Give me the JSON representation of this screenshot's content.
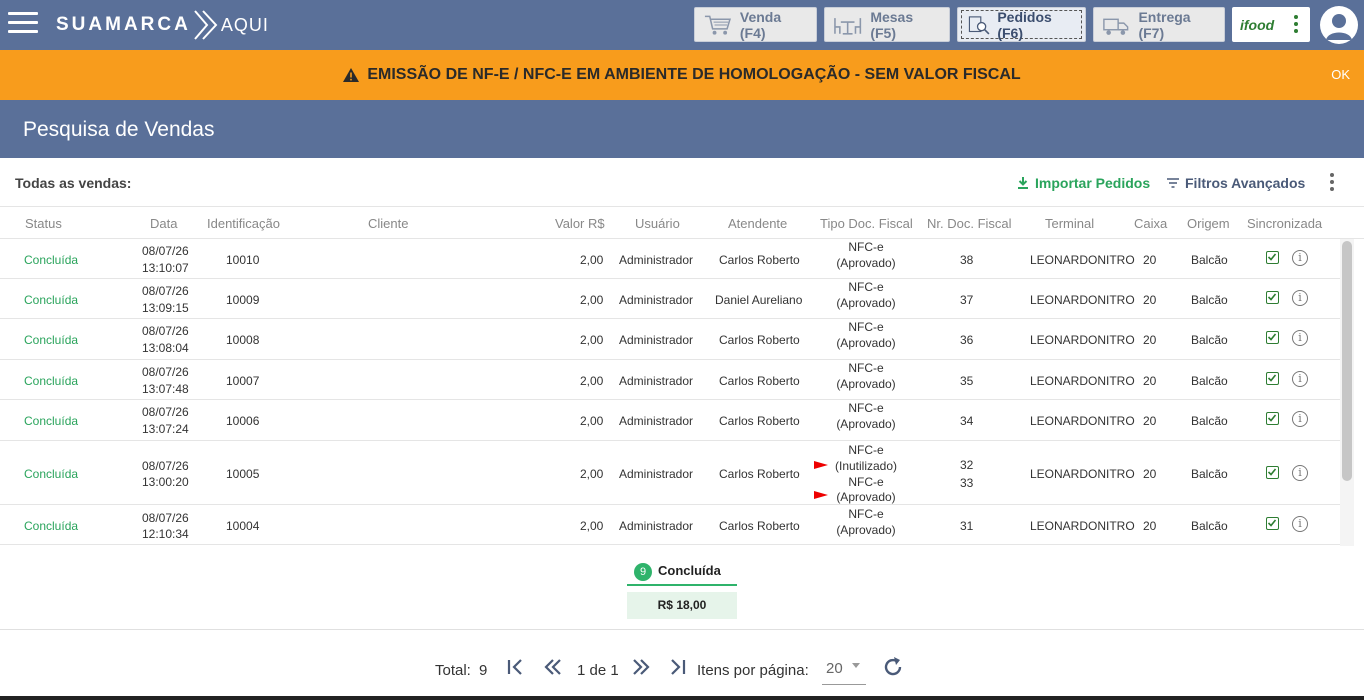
{
  "app": {
    "logo_main": "SUAMARCA",
    "logo_sub": "AQUI"
  },
  "nav": [
    {
      "label": "Venda (F4)",
      "icon": "cart-icon",
      "active": false
    },
    {
      "label": "Mesas (F5)",
      "icon": "tables-icon",
      "active": false
    },
    {
      "label": "Pedidos (F6)",
      "icon": "order-search-icon",
      "active": true
    },
    {
      "label": "Entrega (F7)",
      "icon": "delivery-truck-icon",
      "active": false
    }
  ],
  "ifood_label": "ifood",
  "warning": {
    "text": "EMISSÃO DE NF-E / NFC-E EM AMBIENTE DE HOMOLOGAÇÃO - SEM VALOR FISCAL",
    "ok": "OK"
  },
  "page": {
    "title": "Pesquisa de Vendas",
    "subtitle": "Todas as vendas:",
    "import_label": "Importar Pedidos",
    "filter_label": "Filtros Avançados"
  },
  "table": {
    "headers": [
      "Status",
      "Data",
      "Identificação",
      "Cliente",
      "Valor R$",
      "Usuário",
      "Atendente",
      "Tipo Doc. Fiscal",
      "Nr. Doc. Fiscal",
      "Terminal",
      "Caixa",
      "Origem",
      "Sincronizada"
    ],
    "rows": [
      {
        "status": "Concluída",
        "date": "08/07/26",
        "time": "13:10:07",
        "id": "10010",
        "client": "",
        "value": "2,00",
        "user": "Administrador",
        "attendant": "Carlos Roberto",
        "doc_type": "NFC-e",
        "doc_status": "(Aprovado)",
        "doc_nr": "38",
        "terminal": "LEONARDONITRO",
        "caixa": "20",
        "origem": "Balcão",
        "synced": true
      },
      {
        "status": "Concluída",
        "date": "08/07/26",
        "time": "13:09:15",
        "id": "10009",
        "client": "",
        "value": "2,00",
        "user": "Administrador",
        "attendant": "Daniel Aureliano",
        "doc_type": "NFC-e",
        "doc_status": "(Aprovado)",
        "doc_nr": "37",
        "terminal": "LEONARDONITRO",
        "caixa": "20",
        "origem": "Balcão",
        "synced": true
      },
      {
        "status": "Concluída",
        "date": "08/07/26",
        "time": "13:08:04",
        "id": "10008",
        "client": "",
        "value": "2,00",
        "user": "Administrador",
        "attendant": "Carlos Roberto",
        "doc_type": "NFC-e",
        "doc_status": "(Aprovado)",
        "doc_nr": "36",
        "terminal": "LEONARDONITRO",
        "caixa": "20",
        "origem": "Balcão",
        "synced": true
      },
      {
        "status": "Concluída",
        "date": "08/07/26",
        "time": "13:07:48",
        "id": "10007",
        "client": "",
        "value": "2,00",
        "user": "Administrador",
        "attendant": "Carlos Roberto",
        "doc_type": "NFC-e",
        "doc_status": "(Aprovado)",
        "doc_nr": "35",
        "terminal": "LEONARDONITRO",
        "caixa": "20",
        "origem": "Balcão",
        "synced": true
      },
      {
        "status": "Concluída",
        "date": "08/07/26",
        "time": "13:07:24",
        "id": "10006",
        "client": "",
        "value": "2,00",
        "user": "Administrador",
        "attendant": "Carlos Roberto",
        "doc_type": "NFC-e",
        "doc_status": "(Aprovado)",
        "doc_nr": "34",
        "terminal": "LEONARDONITRO",
        "caixa": "20",
        "origem": "Balcão",
        "synced": true
      },
      {
        "status": "Concluída",
        "date": "08/07/26",
        "time": "13:00:20",
        "id": "10005",
        "client": "",
        "value": "2,00",
        "user": "Administrador",
        "attendant": "Carlos Roberto",
        "doc_type": "NFC-e",
        "doc_status": "(Inutilizado)",
        "doc_type_2": "NFC-e",
        "doc_status_2": "(Aprovado)",
        "doc_nr": "32",
        "doc_nr_2": "33",
        "terminal": "LEONARDONITRO",
        "caixa": "20",
        "origem": "Balcão",
        "synced": true
      },
      {
        "status": "Concluída",
        "date": "08/07/26",
        "time": "12:10:34",
        "id": "10004",
        "client": "",
        "value": "2,00",
        "user": "Administrador",
        "attendant": "Carlos Roberto",
        "doc_type": "NFC-e",
        "doc_status": "(Aprovado)",
        "doc_nr": "31",
        "terminal": "LEONARDONITRO",
        "caixa": "20",
        "origem": "Balcão",
        "synced": true
      }
    ]
  },
  "summary": {
    "count": "9",
    "label": "Concluída",
    "value": "R$ 18,00"
  },
  "pagination": {
    "total_label": "Total:",
    "total": "9",
    "page_info": "1 de 1",
    "per_page_label": "Itens por página:",
    "per_page": "20"
  },
  "colors": {
    "header_bg": "#5a7099",
    "warning_bg": "#f89c1c",
    "status_green": "#2aa45c"
  }
}
